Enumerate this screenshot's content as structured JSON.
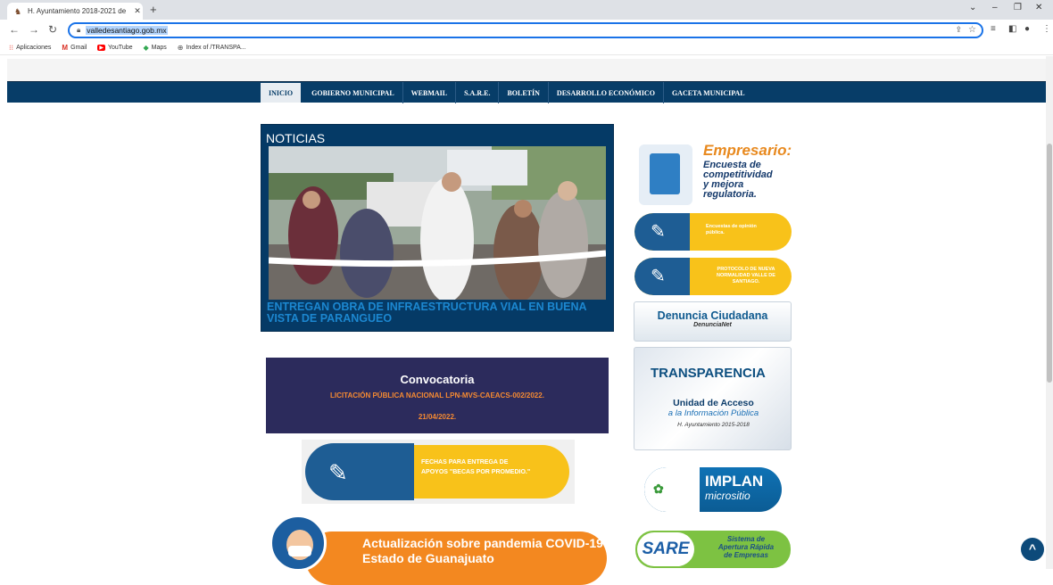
{
  "browser": {
    "tab_title": "H. Ayuntamiento 2018-2021 de",
    "url": "valledesantiago.gob.mx",
    "bookmarks": [
      {
        "icon": "apps-grid-icon",
        "glyph": "⋮⋮",
        "label": "Aplicaciones"
      },
      {
        "icon": "gmail-icon",
        "glyph": "M",
        "label": "Gmail"
      },
      {
        "icon": "youtube-icon",
        "glyph": "▶",
        "label": "YouTube"
      },
      {
        "icon": "maps-icon",
        "glyph": "◆",
        "label": "Maps"
      },
      {
        "icon": "globe-icon",
        "glyph": "⊕",
        "label": "Index of /TRANSPA..."
      }
    ]
  },
  "menu": {
    "items": [
      "INICIO",
      "GOBIERNO MUNICIPAL",
      "WEBMAIL",
      "S.A.R.E.",
      "BOLETÍN",
      "DESARROLLO ECONÓMICO",
      "GACETA MUNICIPAL"
    ]
  },
  "news": {
    "heading": "NOTICIAS",
    "headline": "ENTREGAN OBRA DE INFRAESTRUCTURA VIAL EN BUENA VISTA DE PARANGUEO"
  },
  "convocatoria": {
    "title": "Convocatoria",
    "line1": "LICITACIÓN PÚBLICA NACIONAL LPN-MVS-CAEACS-002/2022.",
    "line2": "21/04/2022."
  },
  "becas": {
    "line1": "FECHAS PARA ENTREGA DE",
    "line2": "APOYOS \"BECAS POR PROMEDIO.\""
  },
  "covid": {
    "line1": "Actualización sobre pandemia COVID-19",
    "line2": "Estado de Guanajuato"
  },
  "sidebar": {
    "empresario_title": "Empresario:",
    "empresario_sub1": "Encuesta de",
    "empresario_sub2": "competitividad",
    "empresario_sub3": "y mejora",
    "empresario_sub4": "regulatoria.",
    "encuestas_1": "Encuestas de opinión",
    "encuestas_2": "pública.",
    "protocolo_1": "PROTOCOLO DE NUEVA",
    "protocolo_2": "NORMALIDAD VALLE DE",
    "protocolo_3": "SANTIAGO.",
    "denuncia_title": "Denuncia Ciudadana",
    "denuncia_sub": "DenunciaNet",
    "transparencia_logo": "TRANSPARENCIA",
    "transparencia_unit": "Unidad de Acceso",
    "transparencia_info": "a la Información Pública",
    "transparencia_years": "H. Ayuntamiento 2015-2018",
    "implan_title": "IMPLAN",
    "implan_sub": "micrositio",
    "sare_logo": "SARE",
    "sare_1": "Sistema de",
    "sare_2": "Apertura Rápida",
    "sare_3": "de Empresas"
  },
  "colors": {
    "menu_bg": "#073d68",
    "accent_orange": "#f38820",
    "headline_blue": "#1c87d0"
  }
}
